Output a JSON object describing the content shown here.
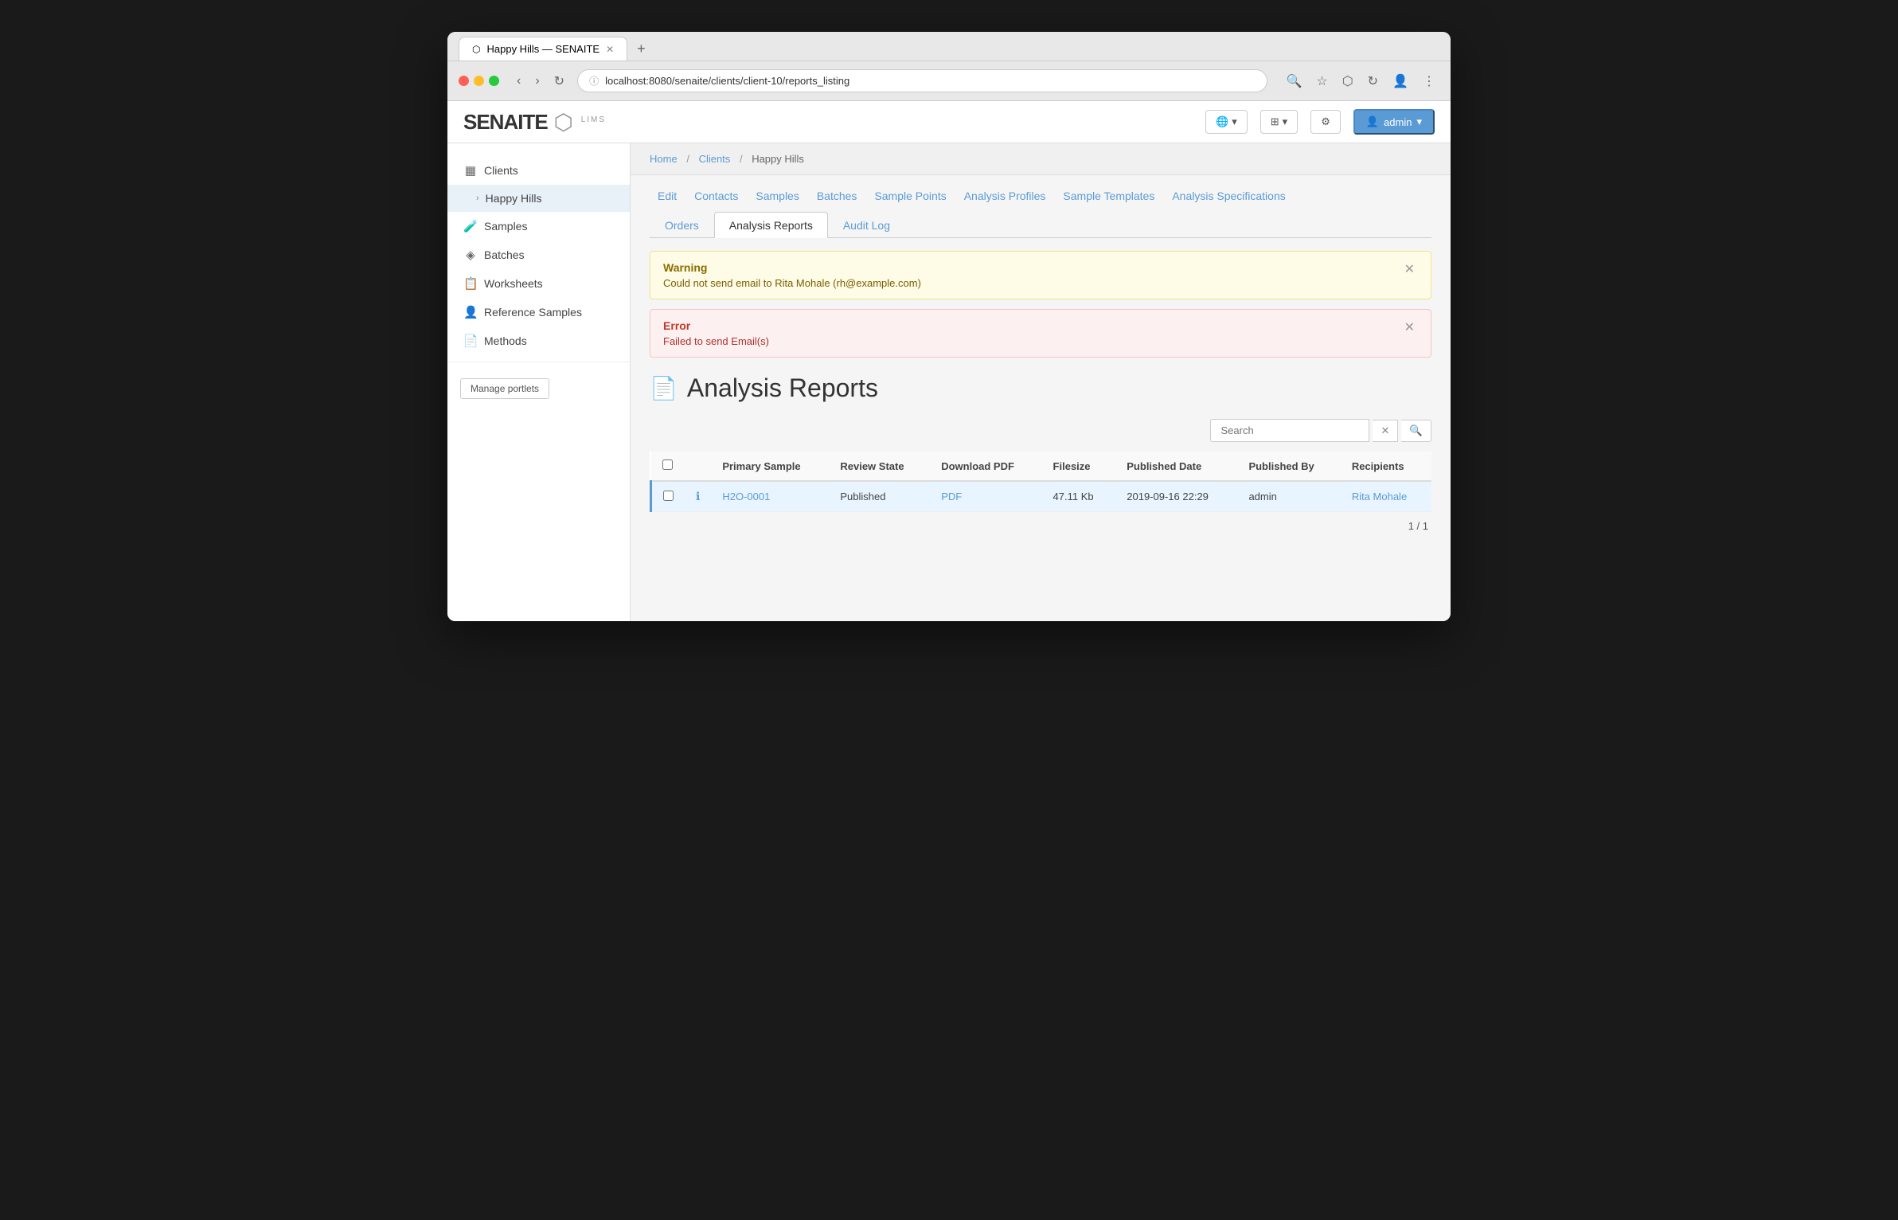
{
  "browser": {
    "tab_title": "Happy Hills — SENAITE",
    "url": "localhost:8080/senaite/clients/client-10/reports_listing",
    "favicon": "⬡"
  },
  "header": {
    "logo_text": "SENAITE",
    "logo_lims": "LIMS",
    "globe_btn": "🌐",
    "apps_btn": "⊞",
    "settings_btn": "⚙",
    "admin_label": "admin"
  },
  "sidebar": {
    "items": [
      {
        "id": "clients",
        "icon": "▦",
        "label": "Clients"
      },
      {
        "id": "happy-hills",
        "icon": "›",
        "label": "Happy Hills",
        "active": true,
        "child": true
      },
      {
        "id": "samples",
        "icon": "🧪",
        "label": "Samples"
      },
      {
        "id": "batches",
        "icon": "◈",
        "label": "Batches"
      },
      {
        "id": "worksheets",
        "icon": "📋",
        "label": "Worksheets"
      },
      {
        "id": "reference-samples",
        "icon": "👤",
        "label": "Reference Samples"
      },
      {
        "id": "methods",
        "icon": "📄",
        "label": "Methods"
      }
    ],
    "manage_portlets": "Manage portlets"
  },
  "breadcrumb": {
    "home": "Home",
    "clients": "Clients",
    "current": "Happy Hills"
  },
  "nav_links": [
    {
      "id": "edit",
      "label": "Edit"
    },
    {
      "id": "contacts",
      "label": "Contacts"
    },
    {
      "id": "samples",
      "label": "Samples"
    },
    {
      "id": "batches",
      "label": "Batches"
    },
    {
      "id": "sample-points",
      "label": "Sample Points"
    },
    {
      "id": "analysis-profiles",
      "label": "Analysis Profiles"
    },
    {
      "id": "sample-templates",
      "label": "Sample Templates"
    },
    {
      "id": "analysis-specifications",
      "label": "Analysis Specifications"
    }
  ],
  "tabs": [
    {
      "id": "orders",
      "label": "Orders"
    },
    {
      "id": "analysis-reports",
      "label": "Analysis Reports",
      "active": true
    },
    {
      "id": "audit-log",
      "label": "Audit Log"
    }
  ],
  "alerts": [
    {
      "id": "warning-alert",
      "type": "warning",
      "title": "Warning",
      "message": "Could not send email to Rita Mohale (rh@example.com)"
    },
    {
      "id": "error-alert",
      "type": "error",
      "title": "Error",
      "message": "Failed to send Email(s)"
    }
  ],
  "page": {
    "title": "Analysis Reports",
    "title_icon": "📄"
  },
  "search": {
    "placeholder": "Search",
    "clear_label": "✕",
    "go_label": "🔍"
  },
  "table": {
    "columns": [
      {
        "id": "select",
        "label": ""
      },
      {
        "id": "info",
        "label": ""
      },
      {
        "id": "primary-sample",
        "label": "Primary Sample"
      },
      {
        "id": "review-state",
        "label": "Review State"
      },
      {
        "id": "download-pdf",
        "label": "Download PDF"
      },
      {
        "id": "filesize",
        "label": "Filesize"
      },
      {
        "id": "published-date",
        "label": "Published Date"
      },
      {
        "id": "published-by",
        "label": "Published By"
      },
      {
        "id": "recipients",
        "label": "Recipients"
      }
    ],
    "rows": [
      {
        "id": "row-1",
        "primary_sample": "H2O-0001",
        "review_state": "Published",
        "download_pdf": "PDF",
        "filesize": "47.11 Kb",
        "published_date": "2019-09-16 22:29",
        "published_by": "admin",
        "recipients": "Rita Mohale"
      }
    ],
    "pagination": "1 / 1"
  }
}
